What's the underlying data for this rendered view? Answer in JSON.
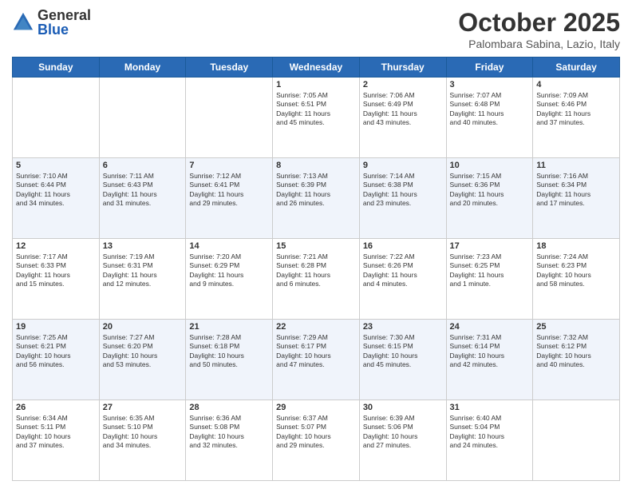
{
  "logo": {
    "general": "General",
    "blue": "Blue"
  },
  "header": {
    "month": "October 2025",
    "location": "Palombara Sabina, Lazio, Italy"
  },
  "days": [
    "Sunday",
    "Monday",
    "Tuesday",
    "Wednesday",
    "Thursday",
    "Friday",
    "Saturday"
  ],
  "weeks": [
    [
      {
        "day": "",
        "info": ""
      },
      {
        "day": "",
        "info": ""
      },
      {
        "day": "",
        "info": ""
      },
      {
        "day": "1",
        "info": "Sunrise: 7:05 AM\nSunset: 6:51 PM\nDaylight: 11 hours\nand 45 minutes."
      },
      {
        "day": "2",
        "info": "Sunrise: 7:06 AM\nSunset: 6:49 PM\nDaylight: 11 hours\nand 43 minutes."
      },
      {
        "day": "3",
        "info": "Sunrise: 7:07 AM\nSunset: 6:48 PM\nDaylight: 11 hours\nand 40 minutes."
      },
      {
        "day": "4",
        "info": "Sunrise: 7:09 AM\nSunset: 6:46 PM\nDaylight: 11 hours\nand 37 minutes."
      }
    ],
    [
      {
        "day": "5",
        "info": "Sunrise: 7:10 AM\nSunset: 6:44 PM\nDaylight: 11 hours\nand 34 minutes."
      },
      {
        "day": "6",
        "info": "Sunrise: 7:11 AM\nSunset: 6:43 PM\nDaylight: 11 hours\nand 31 minutes."
      },
      {
        "day": "7",
        "info": "Sunrise: 7:12 AM\nSunset: 6:41 PM\nDaylight: 11 hours\nand 29 minutes."
      },
      {
        "day": "8",
        "info": "Sunrise: 7:13 AM\nSunset: 6:39 PM\nDaylight: 11 hours\nand 26 minutes."
      },
      {
        "day": "9",
        "info": "Sunrise: 7:14 AM\nSunset: 6:38 PM\nDaylight: 11 hours\nand 23 minutes."
      },
      {
        "day": "10",
        "info": "Sunrise: 7:15 AM\nSunset: 6:36 PM\nDaylight: 11 hours\nand 20 minutes."
      },
      {
        "day": "11",
        "info": "Sunrise: 7:16 AM\nSunset: 6:34 PM\nDaylight: 11 hours\nand 17 minutes."
      }
    ],
    [
      {
        "day": "12",
        "info": "Sunrise: 7:17 AM\nSunset: 6:33 PM\nDaylight: 11 hours\nand 15 minutes."
      },
      {
        "day": "13",
        "info": "Sunrise: 7:19 AM\nSunset: 6:31 PM\nDaylight: 11 hours\nand 12 minutes."
      },
      {
        "day": "14",
        "info": "Sunrise: 7:20 AM\nSunset: 6:29 PM\nDaylight: 11 hours\nand 9 minutes."
      },
      {
        "day": "15",
        "info": "Sunrise: 7:21 AM\nSunset: 6:28 PM\nDaylight: 11 hours\nand 6 minutes."
      },
      {
        "day": "16",
        "info": "Sunrise: 7:22 AM\nSunset: 6:26 PM\nDaylight: 11 hours\nand 4 minutes."
      },
      {
        "day": "17",
        "info": "Sunrise: 7:23 AM\nSunset: 6:25 PM\nDaylight: 11 hours\nand 1 minute."
      },
      {
        "day": "18",
        "info": "Sunrise: 7:24 AM\nSunset: 6:23 PM\nDaylight: 10 hours\nand 58 minutes."
      }
    ],
    [
      {
        "day": "19",
        "info": "Sunrise: 7:25 AM\nSunset: 6:21 PM\nDaylight: 10 hours\nand 56 minutes."
      },
      {
        "day": "20",
        "info": "Sunrise: 7:27 AM\nSunset: 6:20 PM\nDaylight: 10 hours\nand 53 minutes."
      },
      {
        "day": "21",
        "info": "Sunrise: 7:28 AM\nSunset: 6:18 PM\nDaylight: 10 hours\nand 50 minutes."
      },
      {
        "day": "22",
        "info": "Sunrise: 7:29 AM\nSunset: 6:17 PM\nDaylight: 10 hours\nand 47 minutes."
      },
      {
        "day": "23",
        "info": "Sunrise: 7:30 AM\nSunset: 6:15 PM\nDaylight: 10 hours\nand 45 minutes."
      },
      {
        "day": "24",
        "info": "Sunrise: 7:31 AM\nSunset: 6:14 PM\nDaylight: 10 hours\nand 42 minutes."
      },
      {
        "day": "25",
        "info": "Sunrise: 7:32 AM\nSunset: 6:12 PM\nDaylight: 10 hours\nand 40 minutes."
      }
    ],
    [
      {
        "day": "26",
        "info": "Sunrise: 6:34 AM\nSunset: 5:11 PM\nDaylight: 10 hours\nand 37 minutes."
      },
      {
        "day": "27",
        "info": "Sunrise: 6:35 AM\nSunset: 5:10 PM\nDaylight: 10 hours\nand 34 minutes."
      },
      {
        "day": "28",
        "info": "Sunrise: 6:36 AM\nSunset: 5:08 PM\nDaylight: 10 hours\nand 32 minutes."
      },
      {
        "day": "29",
        "info": "Sunrise: 6:37 AM\nSunset: 5:07 PM\nDaylight: 10 hours\nand 29 minutes."
      },
      {
        "day": "30",
        "info": "Sunrise: 6:39 AM\nSunset: 5:06 PM\nDaylight: 10 hours\nand 27 minutes."
      },
      {
        "day": "31",
        "info": "Sunrise: 6:40 AM\nSunset: 5:04 PM\nDaylight: 10 hours\nand 24 minutes."
      },
      {
        "day": "",
        "info": ""
      }
    ]
  ]
}
